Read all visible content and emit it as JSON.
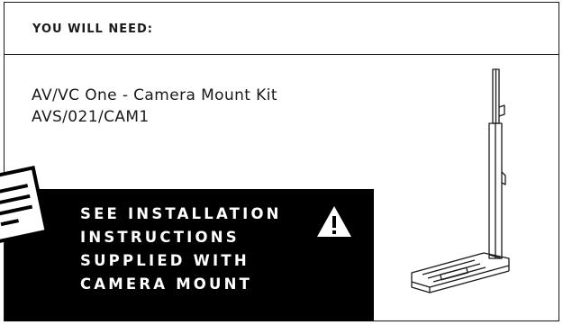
{
  "header": {
    "title": "YOU WILL NEED:"
  },
  "item": {
    "name": "AV/VC One - Camera Mount Kit",
    "code": "AVS/021/CAM1"
  },
  "notice": {
    "lines": [
      "SEE INSTALLATION",
      "INSTRUCTIONS",
      "SUPPLIED WITH",
      "CAMERA MOUNT"
    ],
    "icon": "warning-triangle-icon",
    "background": "#000000",
    "text_color": "#ffffff"
  },
  "icons": {
    "document": "document-icon",
    "camera_mount": "camera-mount-illustration"
  }
}
